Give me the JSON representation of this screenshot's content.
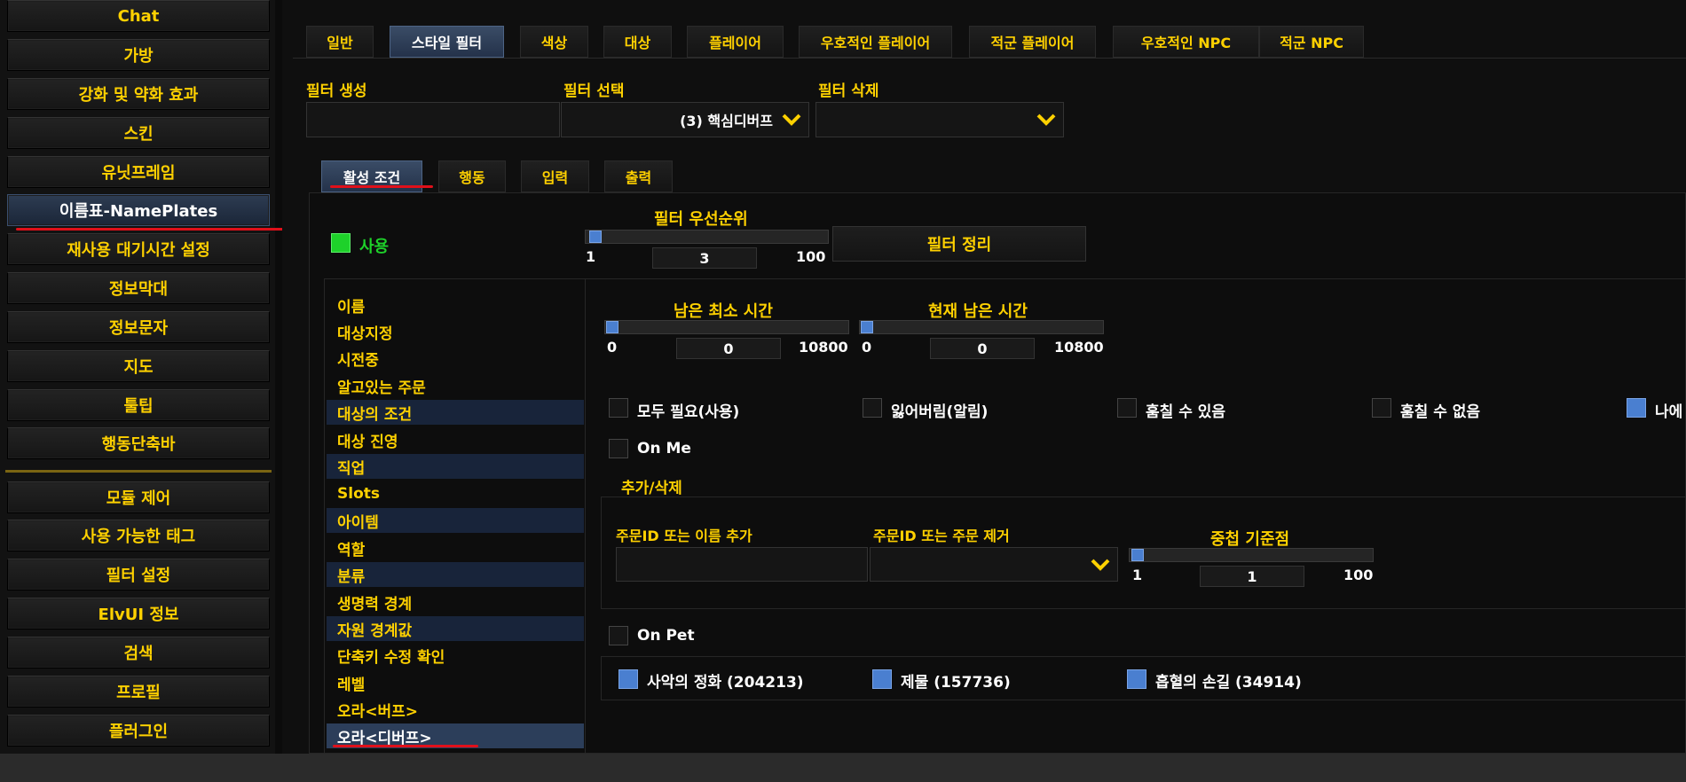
{
  "sidebar": {
    "items": [
      {
        "label": "Chat"
      },
      {
        "label": "가방"
      },
      {
        "label": "강화 및 약화 효과"
      },
      {
        "label": "스킨"
      },
      {
        "label": "유닛프레임"
      },
      {
        "label": "이름표-NamePlates"
      },
      {
        "label": "재사용 대기시간 설정"
      },
      {
        "label": "정보막대"
      },
      {
        "label": "정보문자"
      },
      {
        "label": "지도"
      },
      {
        "label": "툴팁"
      },
      {
        "label": "행동단축바"
      }
    ],
    "lower_items": [
      {
        "label": "모듈 제어"
      },
      {
        "label": "사용 가능한 태그"
      },
      {
        "label": "필터 설정"
      },
      {
        "label": "ElvUI 정보"
      },
      {
        "label": "검색"
      },
      {
        "label": "프로필"
      },
      {
        "label": "플러그인"
      }
    ]
  },
  "tabs": [
    {
      "label": "일반"
    },
    {
      "label": "스타일 필터"
    },
    {
      "label": "색상"
    },
    {
      "label": "대상"
    },
    {
      "label": "플레이어"
    },
    {
      "label": "우호적인 플레이어"
    },
    {
      "label": "적군 플레이어"
    },
    {
      "label": "우호적인 NPC"
    },
    {
      "label": "적군 NPC"
    }
  ],
  "filter": {
    "create_label": "필터 생성",
    "select_label": "필터 선택",
    "select_value": "(3) 핵심디버프",
    "delete_label": "필터 삭제"
  },
  "subtabs": [
    {
      "label": "활성 조건"
    },
    {
      "label": "행동"
    },
    {
      "label": "입력"
    },
    {
      "label": "출력"
    }
  ],
  "enable": {
    "label": "사용"
  },
  "priority": {
    "label": "필터 우선순위",
    "min": "1",
    "value": "3",
    "max": "100"
  },
  "filter_cleanup_label": "필터 정리",
  "conditions": [
    {
      "label": "이름"
    },
    {
      "label": "대상지정"
    },
    {
      "label": "시전중"
    },
    {
      "label": "알고있는 주문"
    },
    {
      "label": "대상의 조건"
    },
    {
      "label": "대상 진영"
    },
    {
      "label": "직업"
    },
    {
      "label": "Slots"
    },
    {
      "label": "아이템"
    },
    {
      "label": "역할"
    },
    {
      "label": "분류"
    },
    {
      "label": "생명력 경계"
    },
    {
      "label": "자원 경계값"
    },
    {
      "label": "단축키 수정 확인"
    },
    {
      "label": "레벨"
    },
    {
      "label": "오라<버프>"
    },
    {
      "label": "오라<디버프>"
    }
  ],
  "min_time": {
    "label": "남은 최소 시간",
    "min": "0",
    "value": "0",
    "max": "10800"
  },
  "cur_time": {
    "label": "현재 남은 시간",
    "min": "0",
    "value": "0",
    "max": "10800"
  },
  "checks": {
    "require_all": "모두 필요(사용)",
    "lost": "잃어버림(알림)",
    "stealable": "훔칠 수 있음",
    "not_stealable": "훔칠 수 없음",
    "from_me": "나에",
    "on_me": "On Me",
    "on_pet": "On Pet"
  },
  "addremove": {
    "title": "추가/삭제",
    "add_label": "주문ID 또는 이름 추가",
    "remove_label": "주문ID 또는 주문 제거",
    "stack_label": "중첩 기준점",
    "stack_min": "1",
    "stack_value": "1",
    "stack_max": "100"
  },
  "spells": [
    {
      "label": "사악의 정화 (204213)"
    },
    {
      "label": "제물 (157736)"
    },
    {
      "label": "흡혈의 손길 (34914)"
    }
  ]
}
